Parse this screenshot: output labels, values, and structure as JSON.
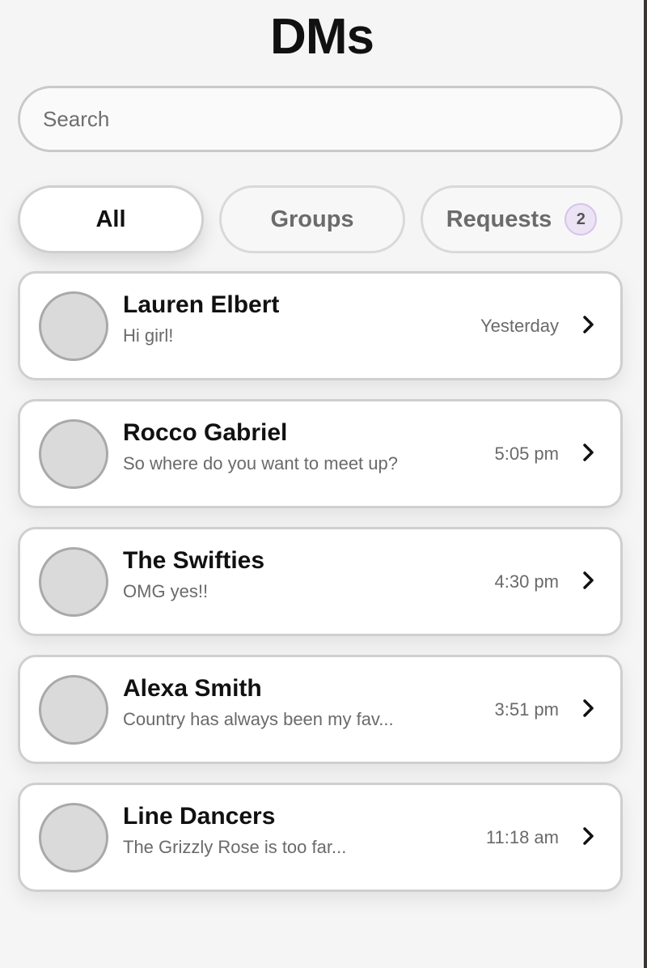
{
  "header": {
    "title": "DMs"
  },
  "search": {
    "placeholder": "Search",
    "value": ""
  },
  "tabs": [
    {
      "label": "All",
      "active": true
    },
    {
      "label": "Groups",
      "active": false
    },
    {
      "label": "Requests",
      "active": false,
      "badge": "2"
    }
  ],
  "conversations": [
    {
      "name": "Lauren Elbert",
      "preview": "Hi girl!",
      "time": "Yesterday"
    },
    {
      "name": "Rocco Gabriel",
      "preview": "So where do you want to meet up?",
      "time": "5:05 pm"
    },
    {
      "name": "The Swifties",
      "preview": "OMG yes!!",
      "time": "4:30 pm"
    },
    {
      "name": "Alexa Smith",
      "preview": "Country has always been my fav...",
      "time": "3:51 pm"
    },
    {
      "name": "Line Dancers",
      "preview": "The Grizzly Rose is too far...",
      "time": "11:18 am"
    }
  ],
  "icons": {
    "row_chevron": "chevron-right-icon",
    "avatar": "avatar-placeholder"
  },
  "colors": {
    "background": "#f5f5f5",
    "card": "#ffffff",
    "border": "#cfcfcf",
    "badge_bg": "#ece3f5",
    "avatar_fill": "#dadada"
  }
}
